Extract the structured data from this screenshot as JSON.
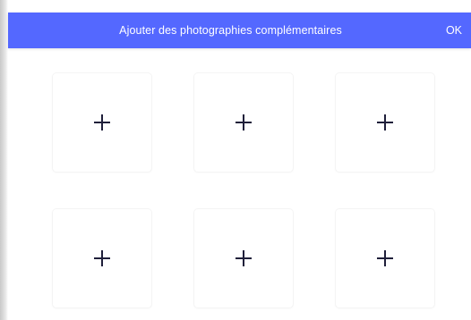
{
  "header": {
    "title": "Ajouter des photographies complémentaires",
    "ok_label": "OK",
    "background_color": "#5468ff"
  },
  "photo_slots": [
    {
      "icon": "plus-icon"
    },
    {
      "icon": "plus-icon"
    },
    {
      "icon": "plus-icon"
    },
    {
      "icon": "plus-icon"
    },
    {
      "icon": "plus-icon"
    },
    {
      "icon": "plus-icon"
    }
  ]
}
